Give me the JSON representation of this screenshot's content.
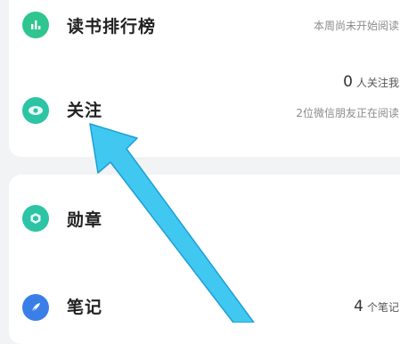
{
  "reading_rank": {
    "title": "读书排行榜",
    "status": "本周尚未开始阅读",
    "icon": "bar-chart-icon"
  },
  "follow": {
    "title": "关注",
    "count": "0",
    "count_text": "人关注我",
    "friends_reading": "2位微信朋友正在阅读",
    "icon": "eye-icon"
  },
  "medals": {
    "title": "勋章",
    "icon": "medal-icon"
  },
  "notes": {
    "title": "笔记",
    "count": "4",
    "count_text": "个笔记",
    "icon": "feather-icon"
  },
  "colors": {
    "green": "#2fc58e",
    "teal": "#2bc4a5",
    "blue": "#3a7ee8",
    "arrow": "#41c8f0"
  }
}
